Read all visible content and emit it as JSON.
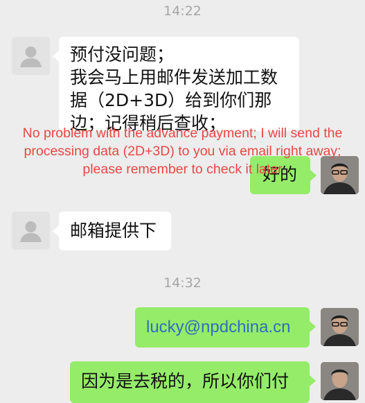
{
  "chat": {
    "timestamp_1": "14:22",
    "timestamp_2": "14:32",
    "messages": {
      "m1": "预付没问题；\n我会马上用邮件发送加工数\n据（2D+3D）给到你们那\n边；记得稍后查收；",
      "m2": "好的",
      "m3": "邮箱提供下",
      "m4": "lucky@npdchina.cn",
      "m5": "因为是去税的，所以你们付"
    }
  },
  "overlay": {
    "translation": "No problem with the advance payment; I will send the\nprocessing data (2D+3D) to you via email right away;\nplease remember to check it later"
  },
  "colors": {
    "background": "#ededed",
    "bubble_left": "#ffffff",
    "bubble_right": "#95ec69",
    "link": "#2f6ebc",
    "translation": "#ea4747"
  },
  "icons": {
    "contact_avatar": "default-person-avatar",
    "self_avatar": "user-photo-avatar"
  }
}
